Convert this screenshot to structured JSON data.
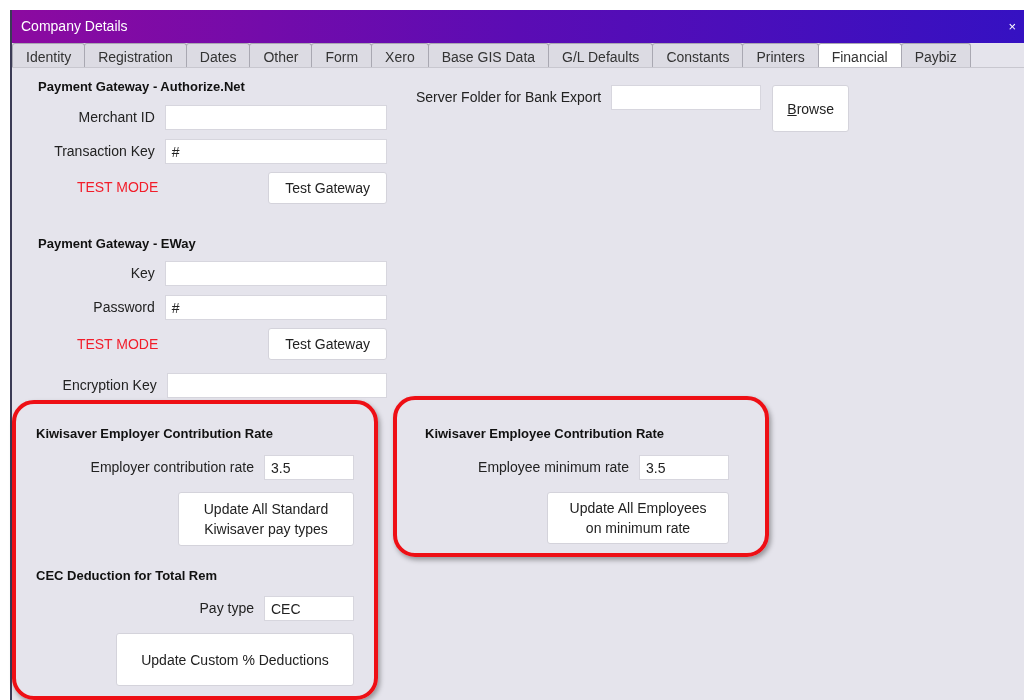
{
  "window": {
    "title": "Company Details",
    "close": "×"
  },
  "tabs": [
    {
      "label": "Identity",
      "selected": false
    },
    {
      "label": "Registration",
      "selected": false
    },
    {
      "label": "Dates",
      "selected": false
    },
    {
      "label": "Other",
      "selected": false
    },
    {
      "label": "Form",
      "selected": false
    },
    {
      "label": "Xero",
      "selected": false
    },
    {
      "label": "Base GIS Data",
      "selected": false
    },
    {
      "label": "G/L Defaults",
      "selected": false
    },
    {
      "label": "Constants",
      "selected": false
    },
    {
      "label": "Printers",
      "selected": false
    },
    {
      "label": "Financial",
      "selected": true
    },
    {
      "label": "Paybiz",
      "selected": false
    }
  ],
  "authorize_net": {
    "heading": "Payment Gateway - Authorize.Net",
    "fields": [
      {
        "label": "Merchant ID"
      },
      {
        "label": "Transaction Key",
        "value": "#"
      }
    ],
    "status": "TEST MODE",
    "button": "Test Gateway"
  },
  "eway": {
    "heading": "Payment Gateway - EWay",
    "fields": [
      {
        "label": "Key"
      },
      {
        "label": "Password",
        "value": "#"
      }
    ],
    "status": "TEST MODE",
    "button": "Test Gateway"
  },
  "encryption_key": {
    "label": "Encryption Key"
  },
  "bank_export": {
    "label": "Server Folder for Bank Export",
    "button": "Browse",
    "first_letter_underlined": true
  },
  "kiwisaver_employer": {
    "highlighted": true,
    "heading": "Kiwisaver Employer Contribution Rate",
    "field": {
      "label": "Employer contribution rate",
      "value": "3.5"
    },
    "button": [
      "Update All Standard",
      "Kiwisaver pay types"
    ],
    "cec": {
      "heading": "CEC Deduction for Total Rem",
      "field": {
        "label": "Pay type",
        "value": "CEC"
      },
      "button": [
        "Update Custom % Deductions"
      ]
    }
  },
  "kiwisaver_employee": {
    "highlighted": true,
    "heading": "Kiwisaver Employee Contribution Rate",
    "field": {
      "label": "Employee minimum rate",
      "value": "3.5"
    },
    "button": [
      "Update All Employees",
      "on minimum rate"
    ]
  }
}
